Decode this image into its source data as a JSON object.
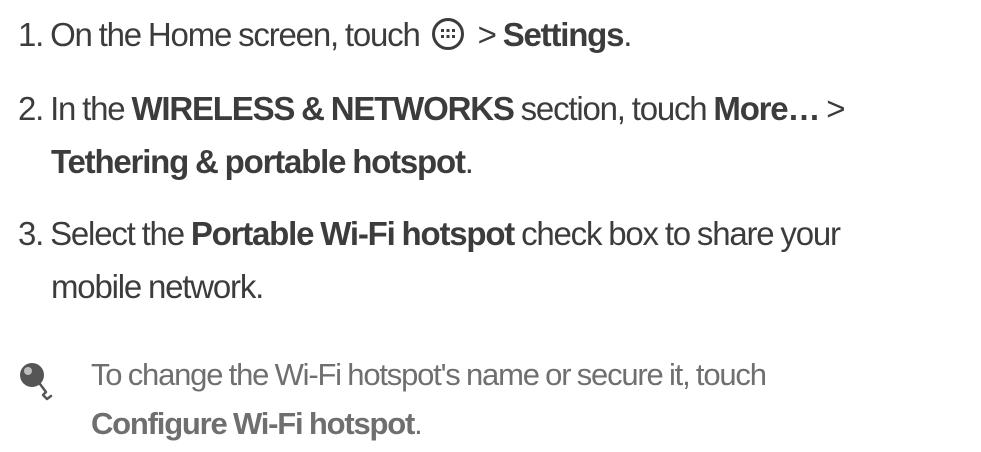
{
  "steps": [
    {
      "number": "1.",
      "line1_pre": "On the Home screen, touch",
      "icon": "apps-grid-icon",
      "line1_sep": ">",
      "line1_bold": "Settings",
      "line1_post": "."
    },
    {
      "number": "2.",
      "line1_pre": "In the",
      "line1_bold1": "WIRELESS & NETWORKS",
      "line1_mid": "section, touch",
      "line1_bold2": "More…",
      "line1_post": ">",
      "line2_bold": "Tethering & portable hotspot",
      "line2_post": "."
    },
    {
      "number": "3.",
      "line1_pre": "Select the",
      "line1_bold": "Portable Wi-Fi hotspot",
      "line1_post": "check box to share your",
      "line2": "mobile network."
    }
  ],
  "tip": {
    "icon": "tip-magnifier-icon",
    "line1": "To change the Wi-Fi hotspot's name or secure it, touch",
    "line2_bold": "Configure Wi-Fi hotspot",
    "line2_post": "."
  },
  "colors": {
    "step_text": "#3c3c3c",
    "tip_text": "#6f6f6f",
    "background": "#ffffff"
  }
}
